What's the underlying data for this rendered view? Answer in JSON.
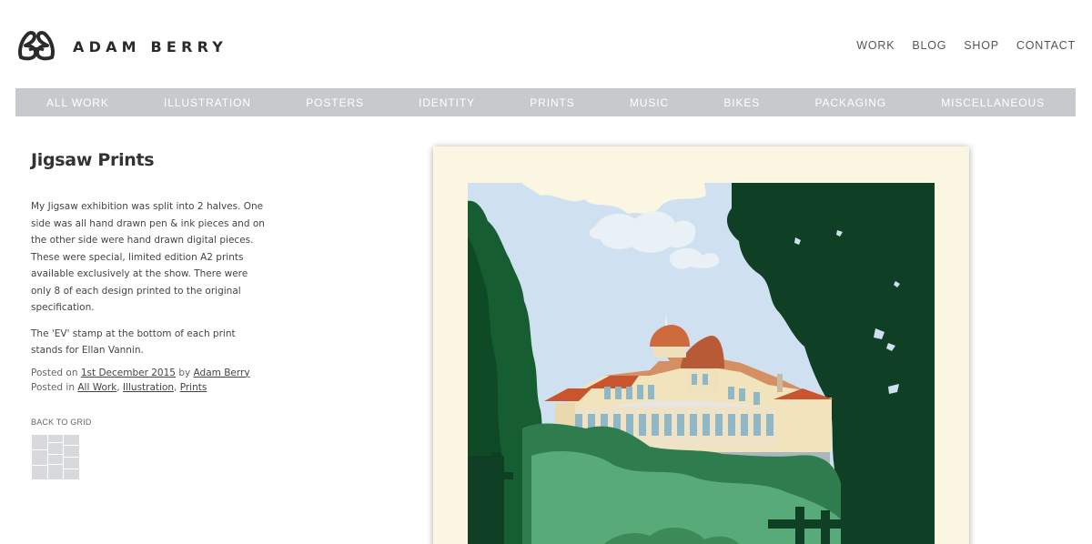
{
  "brand": {
    "name": "ADAM BERRY",
    "logo_icon": "ab-monogram-icon"
  },
  "top_nav": [
    {
      "label": "WORK"
    },
    {
      "label": "BLOG"
    },
    {
      "label": "SHOP"
    },
    {
      "label": "CONTACT"
    }
  ],
  "categories": [
    {
      "label": "ALL WORK"
    },
    {
      "label": "ILLUSTRATION"
    },
    {
      "label": "POSTERS"
    },
    {
      "label": "IDENTITY"
    },
    {
      "label": "PRINTS"
    },
    {
      "label": "MUSIC"
    },
    {
      "label": "BIKES"
    },
    {
      "label": "PACKAGING"
    },
    {
      "label": "MISCELLANEOUS"
    }
  ],
  "post": {
    "title": "Jigsaw Prints",
    "paragraph1": "My Jigsaw exhibition was split into 2 halves. One side was all hand drawn pen & ink pieces and on the other side were hand drawn digital pieces. These were special, limited edition A2 prints available exclusively at the show. There were only 8 of each design printed to the original specification.",
    "paragraph2": "The 'EV' stamp at the bottom of each print stands for Ellan Vannin.",
    "posted_on_prefix": "Posted on ",
    "date": "1st December 2015",
    "by_text": " by ",
    "author": "Adam Berry",
    "posted_in_prefix": "Posted in ",
    "tags": [
      "All Work",
      "Illustration",
      "Prints"
    ],
    "tag_separator": ", ",
    "back_label": "BACK TO GRID",
    "grid_icon": "grid-icon"
  },
  "colors": {
    "category_bar": "#c8c9cb",
    "art_background": "#faf6e1",
    "sky": "#cfe1f1",
    "dark_green": "#0f3f24",
    "mid_green": "#2f7c4f",
    "light_green": "#58ab78",
    "roof": "#c9552f"
  }
}
